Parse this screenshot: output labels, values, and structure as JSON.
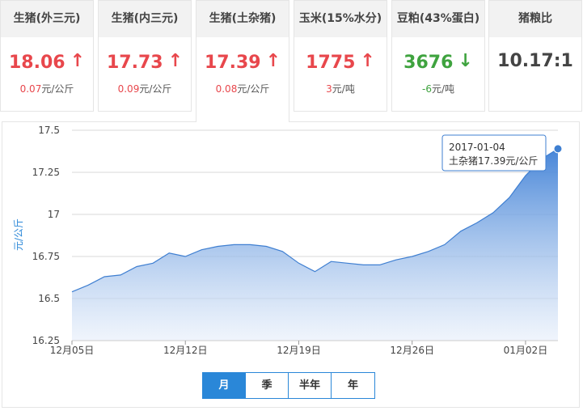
{
  "cards": [
    {
      "title": "生猪(外三元)",
      "price": "18.06",
      "arrow": "↑",
      "change": "0.07",
      "unit": "元/公斤",
      "dir": "up"
    },
    {
      "title": "生猪(内三元)",
      "price": "17.73",
      "arrow": "↑",
      "change": "0.09",
      "unit": "元/公斤",
      "dir": "up"
    },
    {
      "title": "生猪(土杂猪)",
      "price": "17.39",
      "arrow": "↑",
      "change": "0.08",
      "unit": "元/公斤",
      "dir": "up"
    },
    {
      "title": "玉米(15%水分)",
      "price": "1775",
      "arrow": "↑",
      "change": "3",
      "unit": "元/吨",
      "dir": "up"
    },
    {
      "title": "豆粕(43%蛋白)",
      "price": "3676",
      "arrow": "↓",
      "change": "-6",
      "unit": "元/吨",
      "dir": "down"
    },
    {
      "title": "猪粮比",
      "price": "10.17:1",
      "arrow": "",
      "change": "",
      "unit": "",
      "dir": "neutral"
    }
  ],
  "periods": [
    "月",
    "季",
    "半年",
    "年"
  ],
  "active_period": "月",
  "colors": {
    "accent": "#2a87d8",
    "up": "#e8474c",
    "down": "#3fa33f",
    "line": "#3f7fd1"
  },
  "tooltip": {
    "date": "2017-01-04",
    "label": "土杂猪17.39元/公斤"
  },
  "chart_data": {
    "type": "area",
    "ylabel": "元/公斤",
    "ylim": [
      16.25,
      17.5
    ],
    "yticks": [
      "16.25",
      "16.5",
      "16.75",
      "17",
      "17.25",
      "17.5"
    ],
    "xtick_labels": [
      "12月05日",
      "12月12日",
      "12月19日",
      "12月26日",
      "01月02日"
    ],
    "x": [
      "12-05",
      "12-06",
      "12-07",
      "12-08",
      "12-09",
      "12-10",
      "12-11",
      "12-12",
      "12-13",
      "12-14",
      "12-15",
      "12-16",
      "12-17",
      "12-18",
      "12-19",
      "12-20",
      "12-21",
      "12-22",
      "12-23",
      "12-24",
      "12-25",
      "12-26",
      "12-27",
      "12-28",
      "12-29",
      "12-30",
      "12-31",
      "01-01",
      "01-02",
      "01-03",
      "01-04"
    ],
    "values": [
      16.54,
      16.58,
      16.63,
      16.64,
      16.69,
      16.71,
      16.77,
      16.75,
      16.79,
      16.81,
      16.82,
      16.82,
      16.81,
      16.78,
      16.71,
      16.66,
      16.72,
      16.71,
      16.7,
      16.7,
      16.73,
      16.75,
      16.78,
      16.82,
      16.9,
      16.95,
      17.01,
      17.1,
      17.23,
      17.33,
      17.39
    ],
    "grid": true
  }
}
